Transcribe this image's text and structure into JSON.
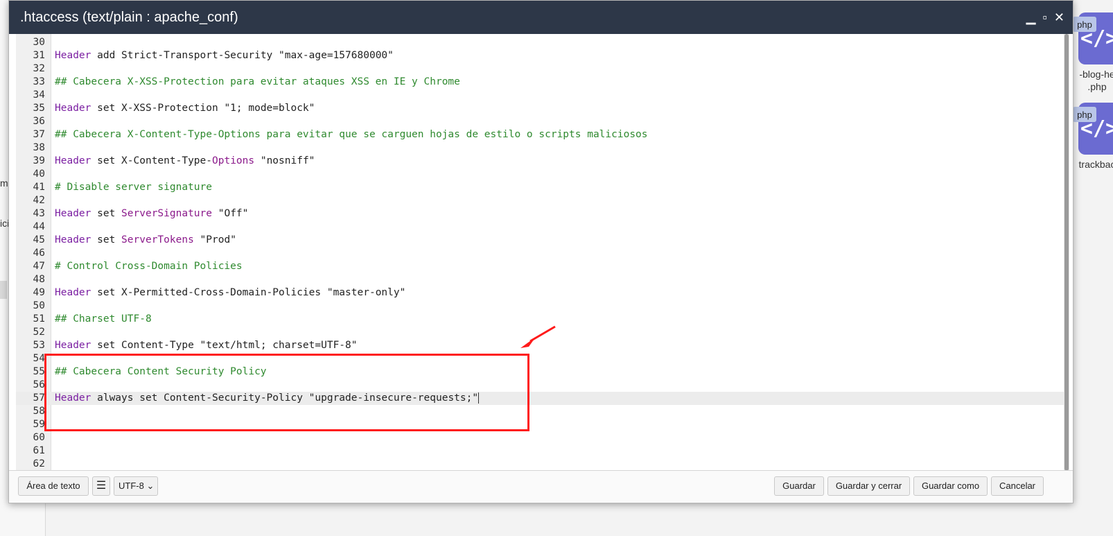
{
  "dialog": {
    "title": ".htaccess (text/plain : apache_conf)",
    "controls": {
      "minimize": "▁",
      "maximize": "▫",
      "close": "✕"
    }
  },
  "editor": {
    "lines": [
      {
        "n": "30",
        "parts": []
      },
      {
        "n": "31",
        "parts": [
          {
            "t": "kw",
            "v": "Header"
          },
          {
            "t": "txt",
            "v": " add Strict-Transport-Security \"max-age=157680000\""
          }
        ]
      },
      {
        "n": "32",
        "parts": []
      },
      {
        "n": "33",
        "parts": [
          {
            "t": "cmt",
            "v": "## Cabecera X-XSS-Protection para evitar ataques XSS en IE y Chrome"
          }
        ]
      },
      {
        "n": "34",
        "parts": []
      },
      {
        "n": "35",
        "parts": [
          {
            "t": "kw",
            "v": "Header"
          },
          {
            "t": "txt",
            "v": " set X-XSS-Protection \"1; mode=block\""
          }
        ]
      },
      {
        "n": "36",
        "parts": []
      },
      {
        "n": "37",
        "parts": [
          {
            "t": "cmt",
            "v": "## Cabecera X-Content-Type-Options para evitar que se carguen hojas de estilo o scripts maliciosos"
          }
        ]
      },
      {
        "n": "38",
        "parts": []
      },
      {
        "n": "39",
        "parts": [
          {
            "t": "kw",
            "v": "Header"
          },
          {
            "t": "txt",
            "v": " set X-Content-Type-"
          },
          {
            "t": "dir",
            "v": "Options"
          },
          {
            "t": "txt",
            "v": " \"nosniff\""
          }
        ]
      },
      {
        "n": "40",
        "parts": []
      },
      {
        "n": "41",
        "parts": [
          {
            "t": "cmt",
            "v": "# Disable server signature"
          }
        ]
      },
      {
        "n": "42",
        "parts": []
      },
      {
        "n": "43",
        "parts": [
          {
            "t": "kw",
            "v": "Header"
          },
          {
            "t": "txt",
            "v": " set "
          },
          {
            "t": "dir",
            "v": "ServerSignature"
          },
          {
            "t": "txt",
            "v": " \"Off\""
          }
        ]
      },
      {
        "n": "44",
        "parts": []
      },
      {
        "n": "45",
        "parts": [
          {
            "t": "kw",
            "v": "Header"
          },
          {
            "t": "txt",
            "v": " set "
          },
          {
            "t": "dir",
            "v": "ServerTokens"
          },
          {
            "t": "txt",
            "v": " \"Prod\""
          }
        ]
      },
      {
        "n": "46",
        "parts": []
      },
      {
        "n": "47",
        "parts": [
          {
            "t": "cmt",
            "v": "# Control Cross-Domain Policies"
          }
        ]
      },
      {
        "n": "48",
        "parts": []
      },
      {
        "n": "49",
        "parts": [
          {
            "t": "kw",
            "v": "Header"
          },
          {
            "t": "txt",
            "v": " set X-Permitted-Cross-Domain-Policies \"master-only\""
          }
        ]
      },
      {
        "n": "50",
        "parts": []
      },
      {
        "n": "51",
        "parts": [
          {
            "t": "cmt",
            "v": "## Charset UTF-8"
          }
        ]
      },
      {
        "n": "52",
        "parts": []
      },
      {
        "n": "53",
        "parts": [
          {
            "t": "kw",
            "v": "Header"
          },
          {
            "t": "txt",
            "v": " set Content-Type \"text/html; charset=UTF-8\""
          }
        ]
      },
      {
        "n": "54",
        "parts": []
      },
      {
        "n": "55",
        "parts": [
          {
            "t": "cmt",
            "v": "## Cabecera Content Security Policy"
          }
        ]
      },
      {
        "n": "56",
        "parts": []
      },
      {
        "n": "57",
        "active": true,
        "cursor": true,
        "parts": [
          {
            "t": "kw",
            "v": "Header"
          },
          {
            "t": "txt",
            "v": " always set Content-Security-Policy \"upgrade-insecure-requests;\""
          }
        ]
      },
      {
        "n": "58",
        "parts": []
      },
      {
        "n": "59",
        "parts": []
      },
      {
        "n": "60",
        "parts": []
      },
      {
        "n": "61",
        "parts": []
      },
      {
        "n": "62",
        "parts": []
      }
    ],
    "colors": {
      "keyword": "#7b1fa2",
      "directive": "#8b1a8b",
      "comment": "#2f8a2f",
      "annotation": "#ff1a1a"
    }
  },
  "footer": {
    "mode_button": "Área de texto",
    "settings_icon": "sliders-icon",
    "encoding": "UTF-8",
    "save": "Guardar",
    "save_close": "Guardar y cerrar",
    "save_as": "Guardar como",
    "cancel": "Cancelar"
  },
  "background": {
    "left_fragments": [
      "m",
      "ici"
    ],
    "files": [
      {
        "badge": "php",
        "name_line1": "-blog-he",
        "name_line2": ".php"
      },
      {
        "badge": "php",
        "name_line1": "trackbac",
        "name_line2": ""
      }
    ]
  }
}
